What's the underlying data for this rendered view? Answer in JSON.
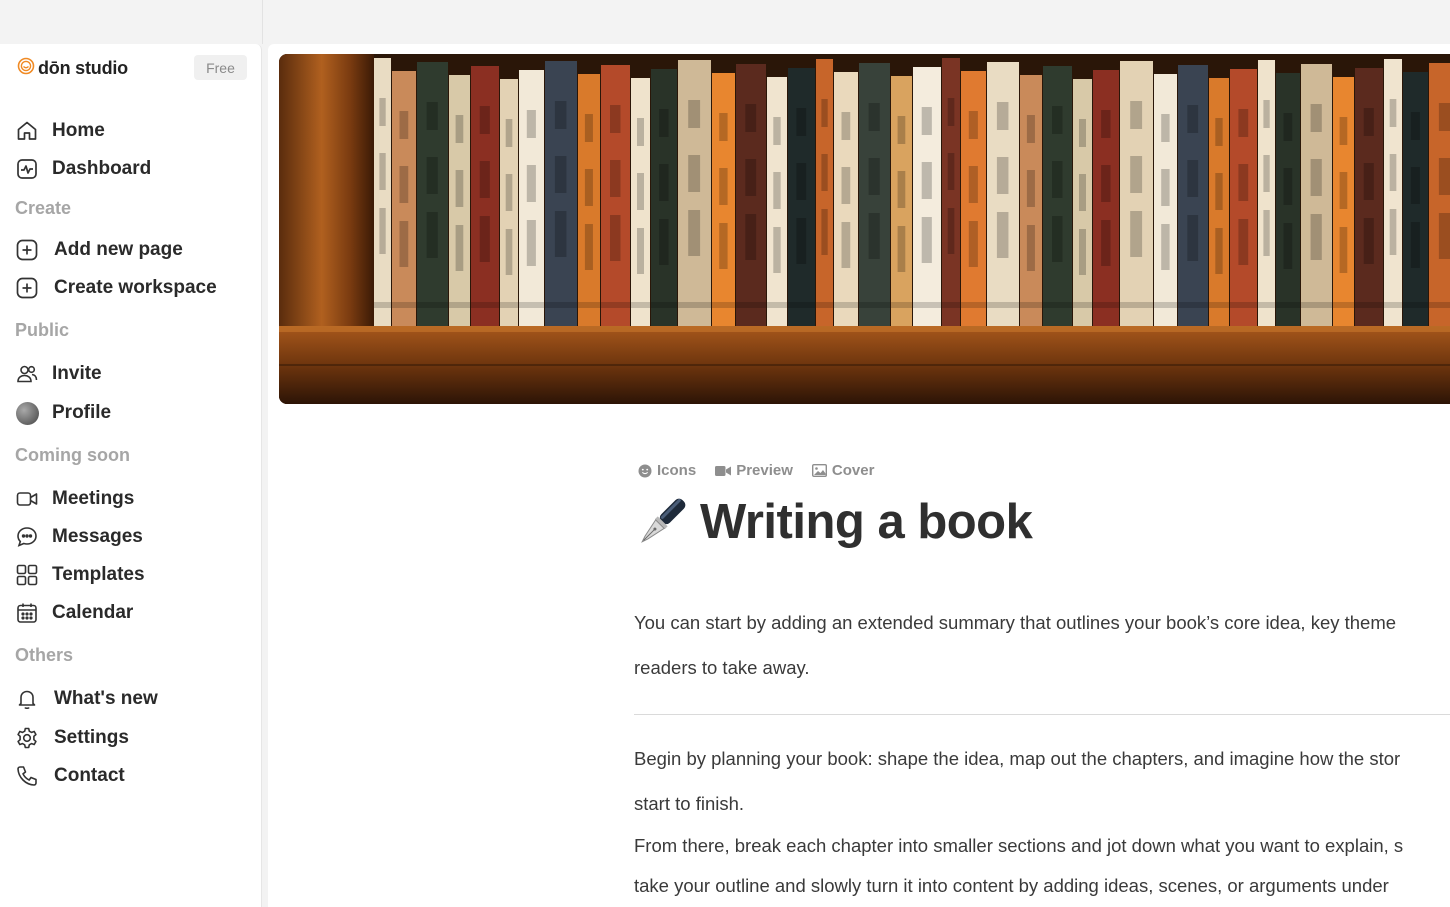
{
  "app": {
    "brand_name": "dōn studio",
    "plan_badge": "Free"
  },
  "sidebar": {
    "home": "Home",
    "dashboard": "Dashboard",
    "section_create": "Create",
    "add_page": "Add new page",
    "create_workspace": "Create workspace",
    "section_public": "Public",
    "invite": "Invite",
    "profile": "Profile",
    "section_coming_soon": "Coming soon",
    "meetings": "Meetings",
    "messages": "Messages",
    "templates": "Templates",
    "calendar": "Calendar",
    "section_others": "Others",
    "whats_new": "What's new",
    "settings": "Settings",
    "contact": "Contact"
  },
  "page": {
    "actions": {
      "icons": "Icons",
      "preview": "Preview",
      "cover": "Cover"
    },
    "title": "Writing a book",
    "title_emoji": "fountain-pen-icon",
    "paragraph1_line1": "You can start by adding an extended summary that outlines your book’s core idea, key theme",
    "paragraph1_line2": "readers to take away.",
    "paragraph2_line1": "Begin by planning your book: shape the idea, map out the chapters, and imagine how the stor",
    "paragraph2_line2": "start to finish.",
    "paragraph3_line1": "From there, break each chapter into smaller sections and jot down what you want to explain, s",
    "paragraph3_line2": "take your outline and slowly turn it into content by adding ideas, scenes, or arguments under"
  },
  "colors": {
    "accent_orange": "#f08a24",
    "text_primary": "#2b2b2b",
    "text_muted": "#a6a6a6"
  }
}
